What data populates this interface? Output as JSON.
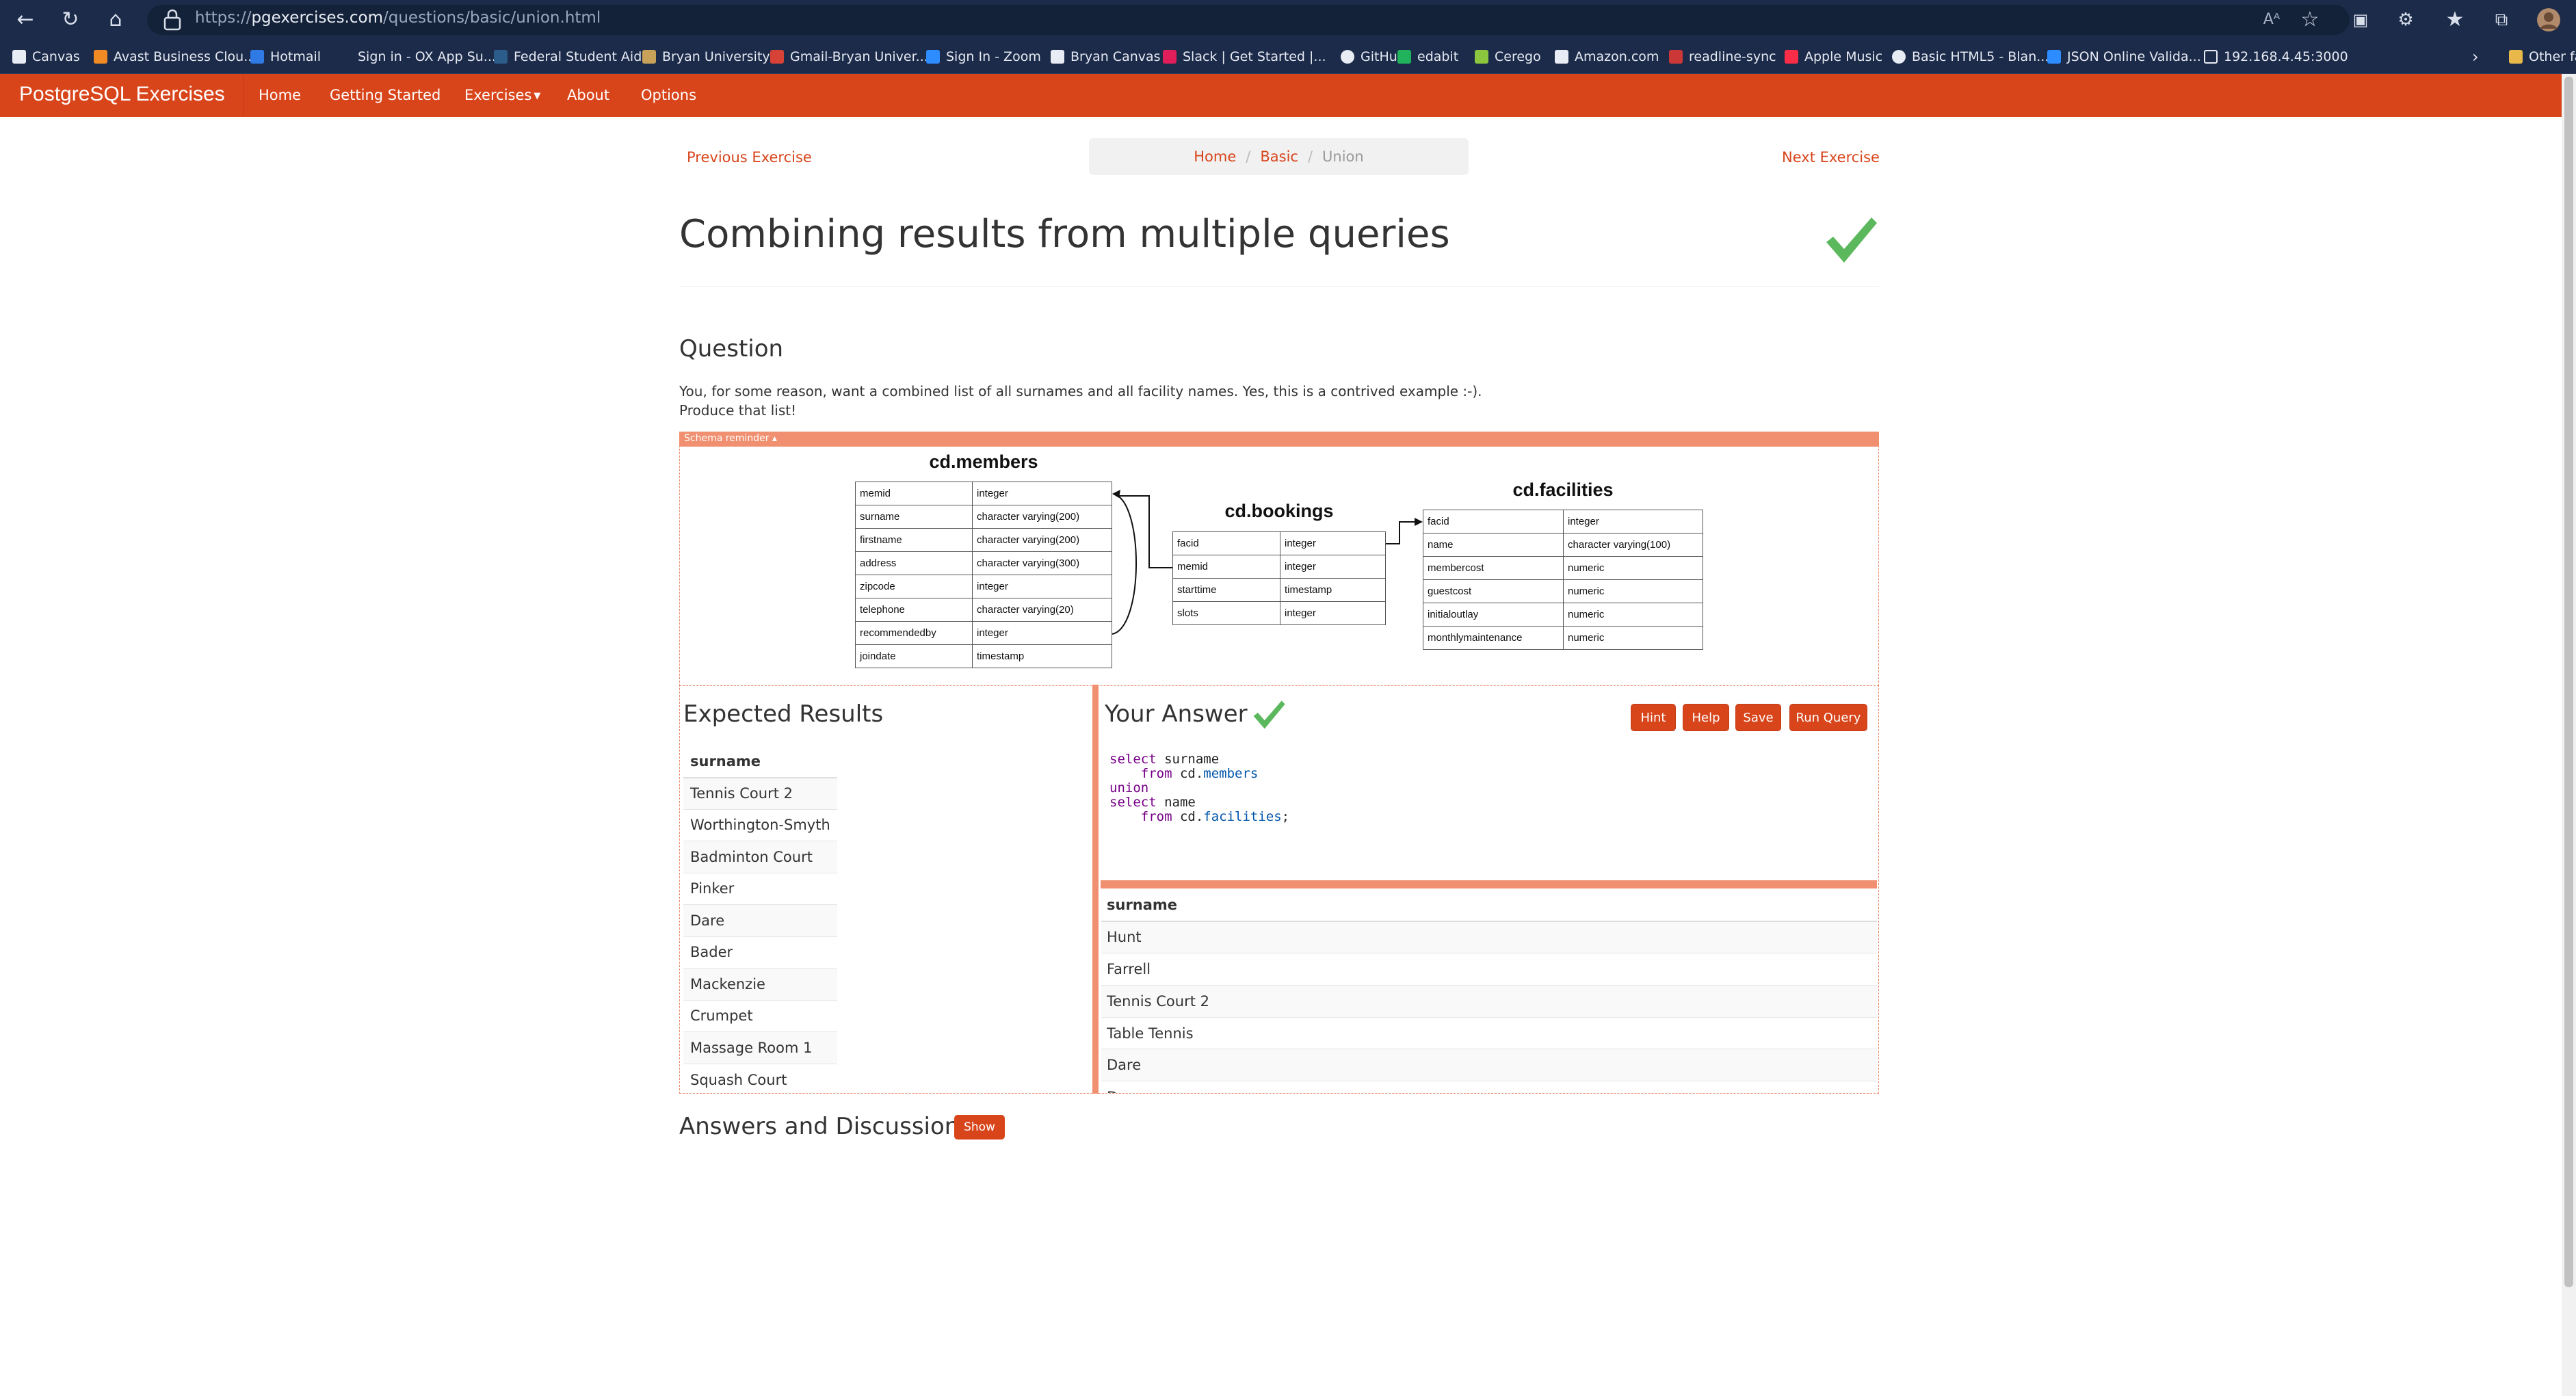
{
  "browser": {
    "url_prefix": "https://",
    "url_host": "pgexercises.com",
    "url_path": "/questions/basic/union.html",
    "reader_icon_text": "Aᴬ",
    "bookmarks": [
      {
        "label": "Canvas",
        "color": "#e8ecf4"
      },
      {
        "label": "Avast Business Clou...",
        "color": "#f08a24"
      },
      {
        "label": "Hotmail",
        "color": "#2f7ae5"
      },
      {
        "label": "Sign in - OX App Su...",
        "color": "#1c2b4a"
      },
      {
        "label": "Federal Student Aid",
        "color": "#2b5c8a"
      },
      {
        "label": "Bryan University",
        "color": "#c9a25a"
      },
      {
        "label": "Gmail-Bryan Univer...",
        "color": "#d64235"
      },
      {
        "label": "Sign In - Zoom",
        "color": "#2d8cff"
      },
      {
        "label": "Bryan Canvas",
        "color": "#e8ecf4"
      },
      {
        "label": "Slack | Get Started |...",
        "color": "#e01e5a"
      },
      {
        "label": "GitHub",
        "color": "#e8ecf4"
      },
      {
        "label": "edabit",
        "color": "#21b35b"
      },
      {
        "label": "Cerego",
        "color": "#8cc63f"
      },
      {
        "label": "Amazon.com",
        "color": "#e8ecf4"
      },
      {
        "label": "readline-sync",
        "color": "#cb3837"
      },
      {
        "label": "Apple Music",
        "color": "#fa2d48"
      },
      {
        "label": "Basic HTML5 - Blan...",
        "color": "#e8ecf4"
      },
      {
        "label": "JSON Online Valida...",
        "color": "#2d8cff"
      },
      {
        "label": "192.168.4.45:3000",
        "color": "#e8ecf4"
      }
    ],
    "other_favorites": "Other fa"
  },
  "navbar": {
    "brand": "PostgreSQL Exercises",
    "items": [
      "Home",
      "Getting Started",
      "Exercises",
      "About",
      "Options"
    ]
  },
  "pager": {
    "previous": "Previous Exercise",
    "next": "Next Exercise"
  },
  "breadcrumb": {
    "home": "Home",
    "section": "Basic",
    "current": "Union"
  },
  "title": "Combining results from multiple queries",
  "question": {
    "heading": "Question",
    "line1": "You, for some reason, want a combined list of all surnames and all facility names. Yes, this is a contrived example :-).",
    "line2": "Produce that list!"
  },
  "schema": {
    "bar_label": "Schema reminder ▴",
    "members": {
      "title": "cd.members",
      "rows": [
        [
          "memid",
          "integer"
        ],
        [
          "surname",
          "character varying(200)"
        ],
        [
          "firstname",
          "character varying(200)"
        ],
        [
          "address",
          "character varying(300)"
        ],
        [
          "zipcode",
          "integer"
        ],
        [
          "telephone",
          "character varying(20)"
        ],
        [
          "recommendedby",
          "integer"
        ],
        [
          "joindate",
          "timestamp"
        ]
      ]
    },
    "bookings": {
      "title": "cd.bookings",
      "rows": [
        [
          "facid",
          "integer"
        ],
        [
          "memid",
          "integer"
        ],
        [
          "starttime",
          "timestamp"
        ],
        [
          "slots",
          "integer"
        ]
      ]
    },
    "facilities": {
      "title": "cd.facilities",
      "rows": [
        [
          "facid",
          "integer"
        ],
        [
          "name",
          "character varying(100)"
        ],
        [
          "membercost",
          "numeric"
        ],
        [
          "guestcost",
          "numeric"
        ],
        [
          "initialoutlay",
          "numeric"
        ],
        [
          "monthlymaintenance",
          "numeric"
        ]
      ]
    }
  },
  "expected": {
    "heading": "Expected Results",
    "column": "surname",
    "rows": [
      "Tennis Court 2",
      "Worthington-Smyth",
      "Badminton Court",
      "Pinker",
      "Dare",
      "Bader",
      "Mackenzie",
      "Crumpet",
      "Massage Room 1",
      "Squash Court"
    ]
  },
  "answer": {
    "heading": "Your Answer",
    "buttons": {
      "hint": "Hint",
      "help": "Help",
      "save": "Save",
      "run": "Run Query"
    },
    "code": {
      "l1_kw": "select",
      "l1_rest": " surname",
      "l2_kw": "    from",
      "l2_schema": " cd.",
      "l2_table": "members",
      "l3_kw": "union",
      "l4_kw": "select",
      "l4_rest": " name",
      "l5_kw": "    from",
      "l5_schema": " cd.",
      "l5_table": "facilities",
      "l5_end": ";"
    },
    "results_column": "surname",
    "results_rows": [
      "Hunt",
      "Farrell",
      "Tennis Court 2",
      "Table Tennis",
      "Dare",
      "Dare"
    ]
  },
  "discussion": {
    "heading": "Answers and Discussion",
    "show": "Show"
  },
  "colors": {
    "brand": "#d9451b",
    "schema_accent": "#f09070",
    "success": "#5cb85c"
  },
  "icons": [
    "back-icon",
    "reload-icon",
    "home-icon",
    "lock-icon",
    "read-aloud-icon",
    "favorite-add-icon",
    "extensions-icon",
    "favorites-icon",
    "collections-icon",
    "profile-avatar",
    "check-icon"
  ]
}
